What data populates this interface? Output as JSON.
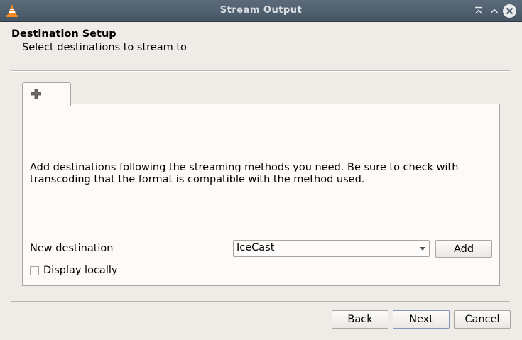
{
  "window": {
    "title": "Stream Output",
    "icon": "vlc-cone-icon"
  },
  "header": {
    "title": "Destination Setup",
    "subtitle": "Select destinations to stream to"
  },
  "tab": {
    "icon": "plus-icon"
  },
  "panel": {
    "info_text": "Add destinations following the streaming methods you need. Be sure to check with transcoding that the format is compatible with the method used.",
    "new_destination_label": "New destination",
    "destination_select_value": "IceCast",
    "add_button_label": "Add",
    "display_locally_label": "Display locally",
    "display_locally_checked": false
  },
  "footer": {
    "back_label": "Back",
    "next_label": "Next",
    "cancel_label": "Cancel"
  },
  "colors": {
    "titlebar": "#4f5f6e",
    "background": "#efebe7",
    "panel": "#fdfaf7",
    "vlc_orange": "#f58a1f"
  }
}
